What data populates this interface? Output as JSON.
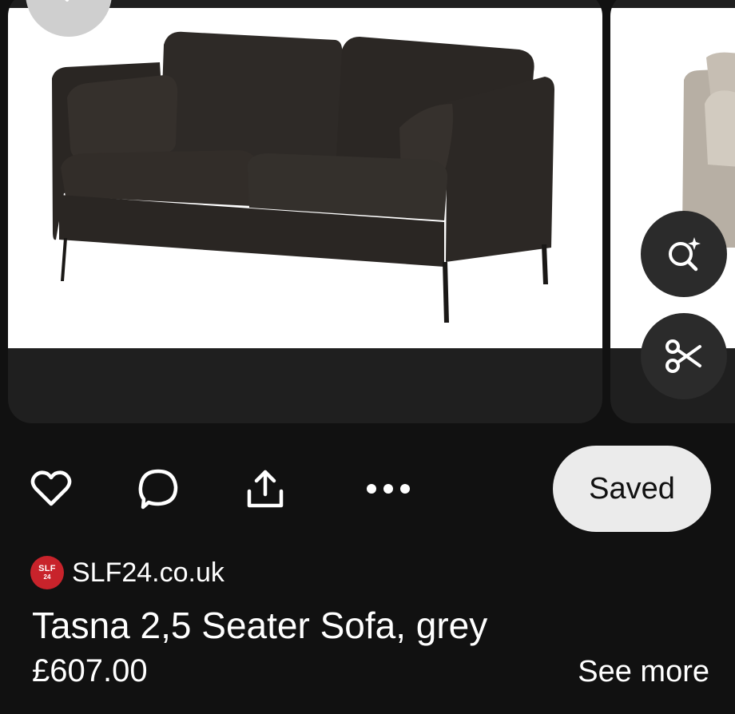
{
  "action_bar": {
    "saved_label": "Saved",
    "icons": [
      "heart-icon",
      "comment-icon",
      "share-icon",
      "more-icon"
    ]
  },
  "side_actions": [
    "visual-search-icon",
    "scissors-icon"
  ],
  "pin": {
    "source_logo_line1": "SLF",
    "source_logo_line2": "24",
    "source_name": "SLF24.co.uk",
    "title": "Tasna 2,5 Seater Sofa, grey",
    "price": "£607.00",
    "see_more": "See more"
  },
  "colors": {
    "background": "#111111",
    "card": "#1f1f1f",
    "saved_button": "#ebebeb",
    "source_logo": "#c8232b",
    "sofa": "#2f2b28",
    "next_sofa": "#b7afa4"
  }
}
